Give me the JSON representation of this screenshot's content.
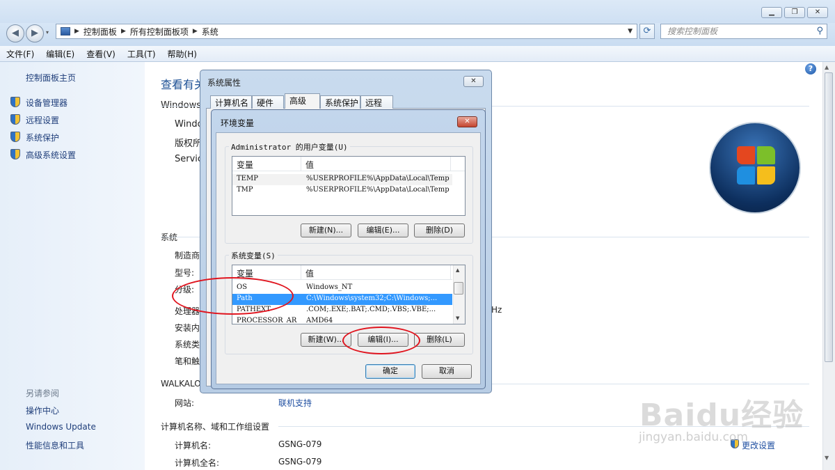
{
  "nav": {
    "breadcrumb": [
      "控制面板",
      "所有控制面板项",
      "系统"
    ],
    "search_placeholder": "搜索控制面板"
  },
  "menu": [
    "文件(F)",
    "编辑(E)",
    "查看(V)",
    "工具(T)",
    "帮助(H)"
  ],
  "sidebar": {
    "home": "控制面板主页",
    "links": [
      "设备管理器",
      "远程设置",
      "系统保护",
      "高级系统设置"
    ],
    "see_also_title": "另请参阅",
    "see_also": [
      "操作中心",
      "Windows Update",
      "性能信息和工具"
    ]
  },
  "main": {
    "title": "查看有关",
    "edition_section": "Windows",
    "edition_lines": [
      "Windo",
      "版权所",
      "Service"
    ],
    "system_section": "系统",
    "system_labels": [
      "制造商",
      "型号:",
      "分级:",
      "处理器",
      "安装内",
      "系统类",
      "笔和触"
    ],
    "cpu_suffix": "Hz",
    "support_section": "WALKALONE",
    "website_label": "网站:",
    "website_value": "联机支持",
    "computer_section": "计算机名称、域和工作组设置",
    "computer_name_label": "计算机名:",
    "computer_name_value": "GSNG-079",
    "full_name_label": "计算机全名:",
    "full_name_value": "GSNG-079",
    "change_settings": "更改设置"
  },
  "sysprops": {
    "title": "系统属性",
    "tabs": [
      "计算机名",
      "硬件",
      "高级",
      "系统保护",
      "远程"
    ],
    "active_tab": "高级"
  },
  "env": {
    "title": "环境变量",
    "user_group": "Administrator 的用户变量(U)",
    "col_var": "变量",
    "col_val": "值",
    "user_rows": [
      {
        "name": "TEMP",
        "value": "%USERPROFILE%\\AppData\\Local\\Temp"
      },
      {
        "name": "TMP",
        "value": "%USERPROFILE%\\AppData\\Local\\Temp"
      }
    ],
    "user_buttons": [
      "新建(N)...",
      "编辑(E)...",
      "删除(D)"
    ],
    "sys_group": "系统变量(S)",
    "sys_rows": [
      {
        "name": "OS",
        "value": "Windows_NT"
      },
      {
        "name": "Path",
        "value": "C:\\Windows\\system32;C:\\Windows;..."
      },
      {
        "name": "PATHEXT",
        "value": ".COM;.EXE;.BAT;.CMD;.VBS;.VBE;..."
      },
      {
        "name": "PROCESSOR_AR",
        "value": "AMD64"
      }
    ],
    "selected_row": "Path",
    "sys_buttons": [
      "新建(W)...",
      "编辑(I)...",
      "删除(L)"
    ],
    "ok": "确定",
    "cancel": "取消"
  },
  "watermark": {
    "main": "Baidu经验",
    "sub": "jingyan.baidu.com"
  },
  "colors": {
    "highlight": "#3399ff",
    "annotation": "#e0141e",
    "link": "#1f3e7a"
  }
}
